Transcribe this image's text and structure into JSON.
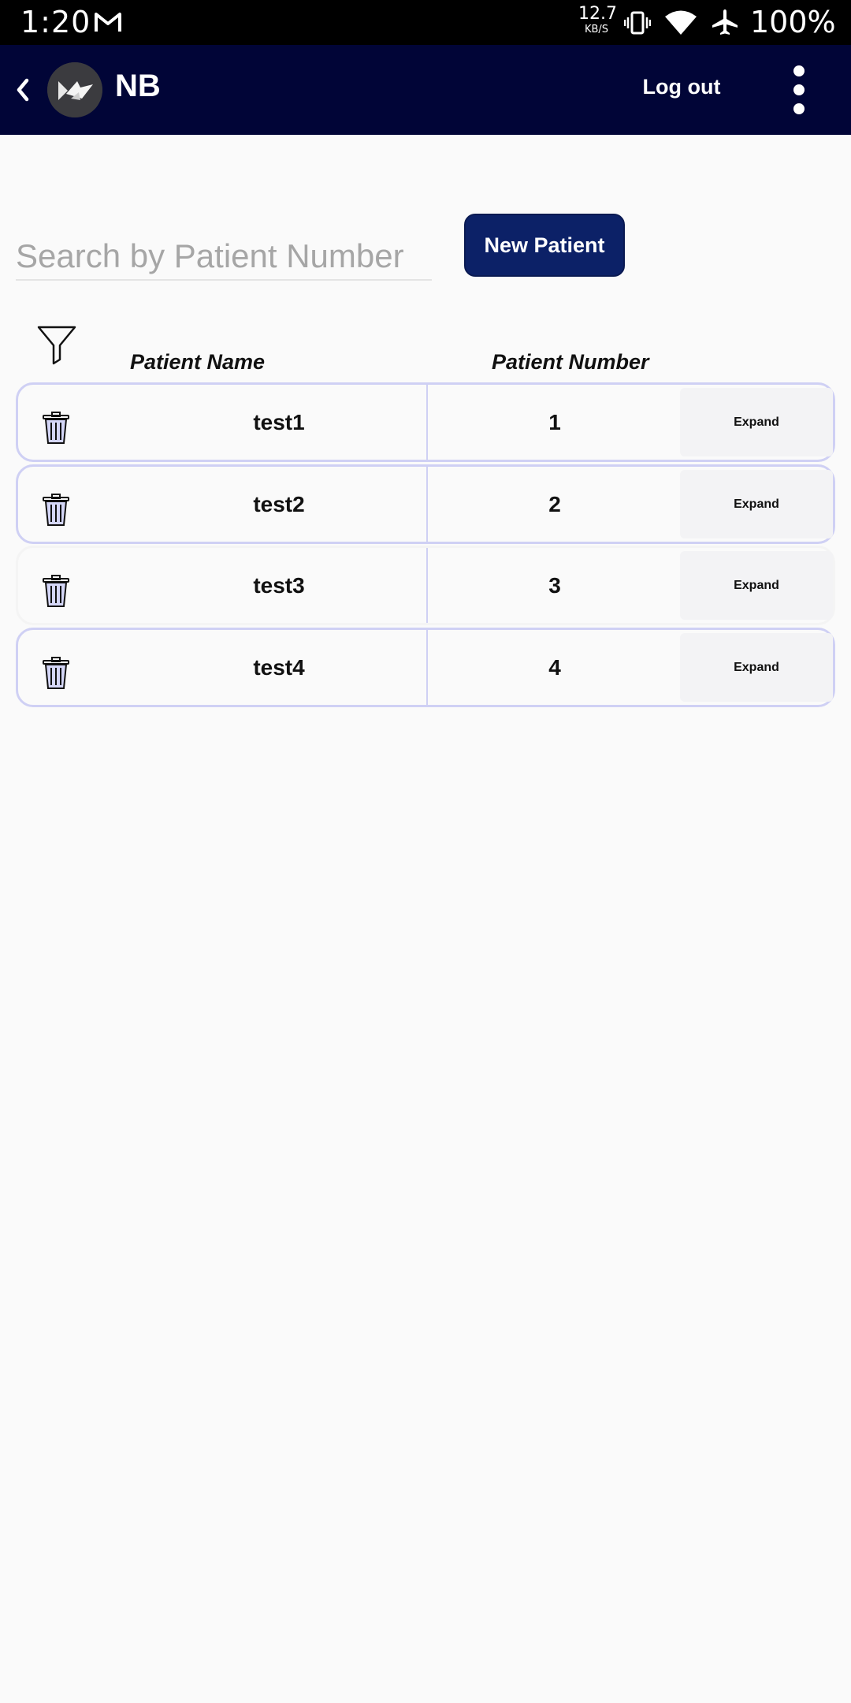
{
  "status_bar": {
    "time": "1:20",
    "net_speed": "12.7",
    "net_unit": "KB/S",
    "battery": "100%",
    "icons": [
      "gmail-icon",
      "vibrate-icon",
      "wifi-icon",
      "airplane-icon"
    ]
  },
  "app_bar": {
    "title": "NB",
    "logout_label": "Log out",
    "background": "#010537"
  },
  "search": {
    "placeholder": "Search by Patient Number",
    "value": ""
  },
  "new_patient_label": "New Patient",
  "table": {
    "headers": {
      "name": "Patient Name",
      "number": "Patient Number"
    },
    "rows": [
      {
        "name": "test1",
        "number": "1",
        "action": "Expand"
      },
      {
        "name": "test2",
        "number": "2",
        "action": "Expand"
      },
      {
        "name": "test3",
        "number": "3",
        "action": "Expand"
      },
      {
        "name": "test4",
        "number": "4",
        "action": "Expand"
      }
    ]
  },
  "colors": {
    "accent": "#0c2167",
    "row_border": "#cfd0f4",
    "expand_bg": "#f3f3f5"
  }
}
